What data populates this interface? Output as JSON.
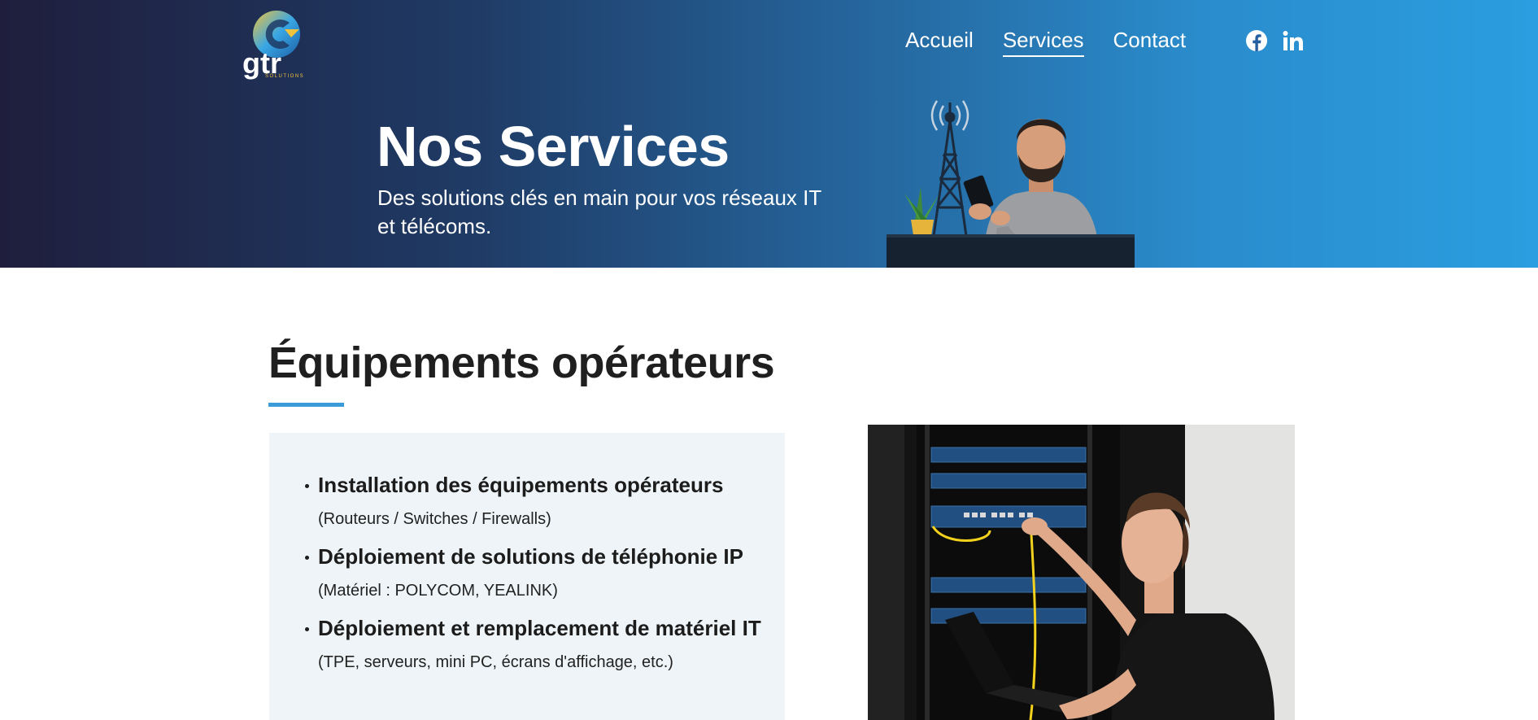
{
  "brand": {
    "logo_text": "gtr",
    "logo_tagline": "SOLUTIONS"
  },
  "nav": {
    "items": [
      {
        "label": "Accueil",
        "active": false
      },
      {
        "label": "Services",
        "active": true
      },
      {
        "label": "Contact",
        "active": false
      }
    ]
  },
  "social": {
    "icons": [
      "facebook-icon",
      "linkedin-icon"
    ]
  },
  "hero": {
    "title": "Nos Services",
    "subtitle": "Des solutions clés en main pour vos réseaux IT et télécoms."
  },
  "section": {
    "title": "Équipements opérateurs",
    "services": [
      {
        "name": "Installation des équipements opérateurs",
        "detail": "(Routeurs / Switches / Firewalls)"
      },
      {
        "name": "Déploiement de solutions de téléphonie IP",
        "detail": "(Matériel : POLYCOM, YEALINK)"
      },
      {
        "name": "Déploiement et remplacement de matériel IT",
        "detail": "(TPE, serveurs, mini PC, écrans d'affichage, etc.)"
      }
    ]
  },
  "colors": {
    "hero_gradient_start": "#1f1e3d",
    "hero_gradient_end": "#2a9ee0",
    "accent": "#3b9bd8",
    "card_bg": "#eef4f7"
  }
}
